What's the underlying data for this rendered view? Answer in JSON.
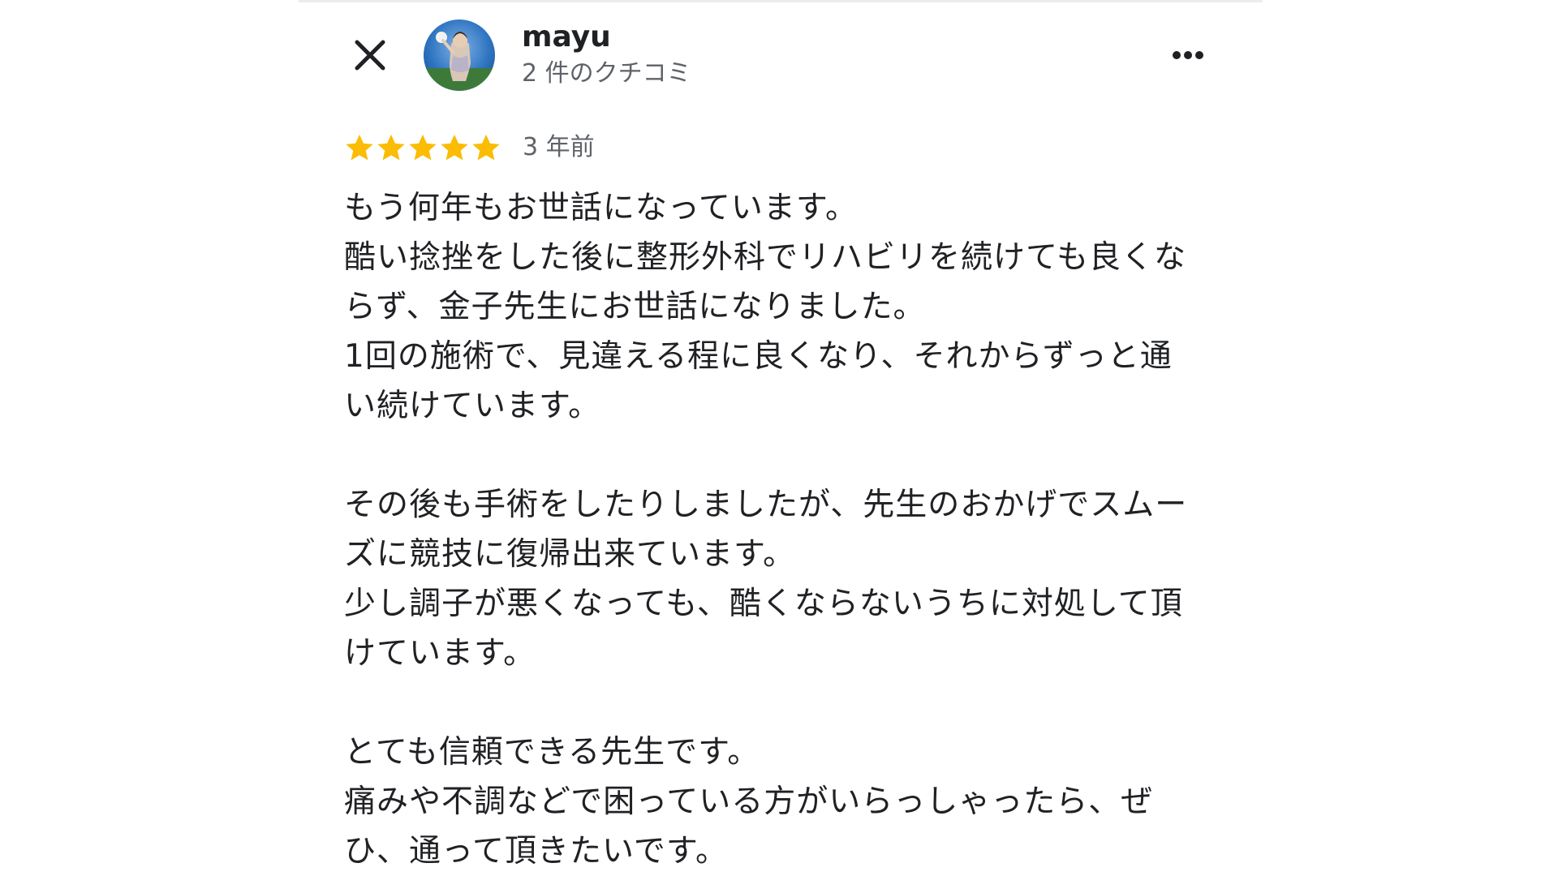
{
  "header": {
    "close_icon": "close-icon",
    "reviewer_name": "mayu",
    "review_count": "2 件のクチコミ",
    "more_icon": "more-horizontal-icon"
  },
  "rating": {
    "stars": 5,
    "max_stars": 5,
    "star_color": "#fbbc04",
    "date": "3 年前"
  },
  "review": {
    "lines": [
      "もう何年もお世話になっています。",
      "酷い捻挫をした後に整形外科でリハビリを続けても良くな",
      "らず、金子先生にお世話になりました。",
      "1回の施術で、見違える程に良くなり、それからずっと通",
      "い続けています。",
      "",
      "その後も手術をしたりしましたが、先生のおかげでスムー",
      "ズに競技に復帰出来ています。",
      "少し調子が悪くなっても、酷くならないうちに対処して頂",
      "けています。",
      "",
      "とても信頼できる先生です。",
      "痛みや不調などで困っている方がいらっしゃったら、ぜ",
      "ひ、通って頂きたいです。"
    ]
  }
}
